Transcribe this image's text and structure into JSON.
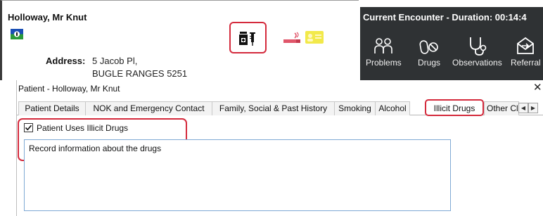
{
  "patient": {
    "name": "Holloway, Mr Knut",
    "address_label": "Address:",
    "address_line1": "5 Jacob Pl,",
    "address_line2": "BUGLE RANGES  5251"
  },
  "encounter": {
    "title": "Current Encounter - Duration: 00:14:4",
    "buttons": [
      {
        "label": "Problems",
        "icon": "problems-icon"
      },
      {
        "label": "Drugs",
        "icon": "drugs-icon"
      },
      {
        "label": "Observations",
        "icon": "stethoscope-icon"
      },
      {
        "label": "Referral",
        "icon": "referral-icon"
      }
    ]
  },
  "dialog": {
    "title": "Patient - Holloway, Mr Knut",
    "close_glyph": "✕",
    "tabs": [
      {
        "label": "Patient Details"
      },
      {
        "label": "NOK and Emergency Contact"
      },
      {
        "label": "Family, Social & Past History"
      },
      {
        "label": "Smoking"
      },
      {
        "label": "Alcohol"
      },
      {
        "label": "Illicit Drugs",
        "active": true
      },
      {
        "label": "Other Cli"
      }
    ],
    "scroll_left": "◀",
    "scroll_right": "▶",
    "checkbox": {
      "label": "Patient Uses Illicit Drugs",
      "checked": true
    },
    "notes_text": "Record information about the drugs"
  },
  "colors": {
    "highlight": "#d42a3c",
    "encounter_bg": "#2f3234",
    "id_card": "#f2e94a",
    "smoking": "#e0566a"
  }
}
